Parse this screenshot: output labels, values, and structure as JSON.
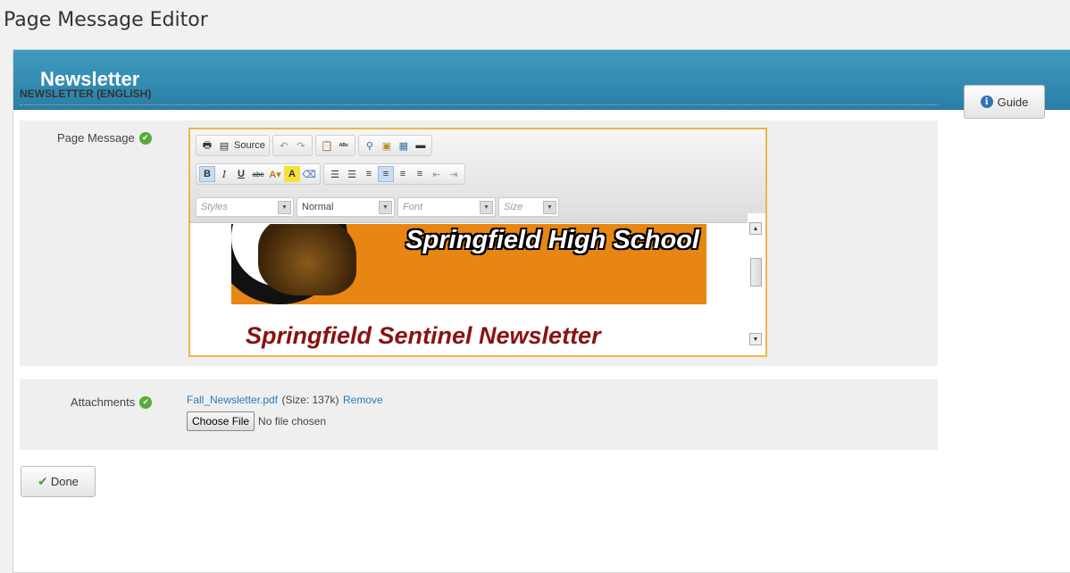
{
  "page": {
    "title": "Page Message Editor"
  },
  "panel": {
    "title": "Newsletter",
    "section_title": "NEWSLETTER (ENGLISH)",
    "guide_label": "Guide",
    "info_glyph": "i"
  },
  "page_message": {
    "label": "Page Message",
    "toolbar": {
      "source_label": "Source",
      "styles_placeholder": "Styles",
      "format_value": "Normal",
      "font_placeholder": "Font",
      "size_placeholder": "Size"
    },
    "content": {
      "banner_text": "Springfield High School",
      "heading": "Springfield Sentinel Newsletter"
    }
  },
  "attachments": {
    "label": "Attachments",
    "file_name": "Fall_Newsletter.pdf",
    "file_size": "(Size: 137k)",
    "remove_label": "Remove",
    "choose_file_label": "Choose File",
    "no_file_text": "No file chosen"
  },
  "actions": {
    "done_label": "Done"
  },
  "colors": {
    "header_blue": "#2a7fa6",
    "editor_focus": "#f0b54a",
    "banner_orange": "#e78612",
    "heading_red": "#8a1212",
    "valid_green": "#5aaa3a",
    "link_blue": "#2a7ab8"
  }
}
